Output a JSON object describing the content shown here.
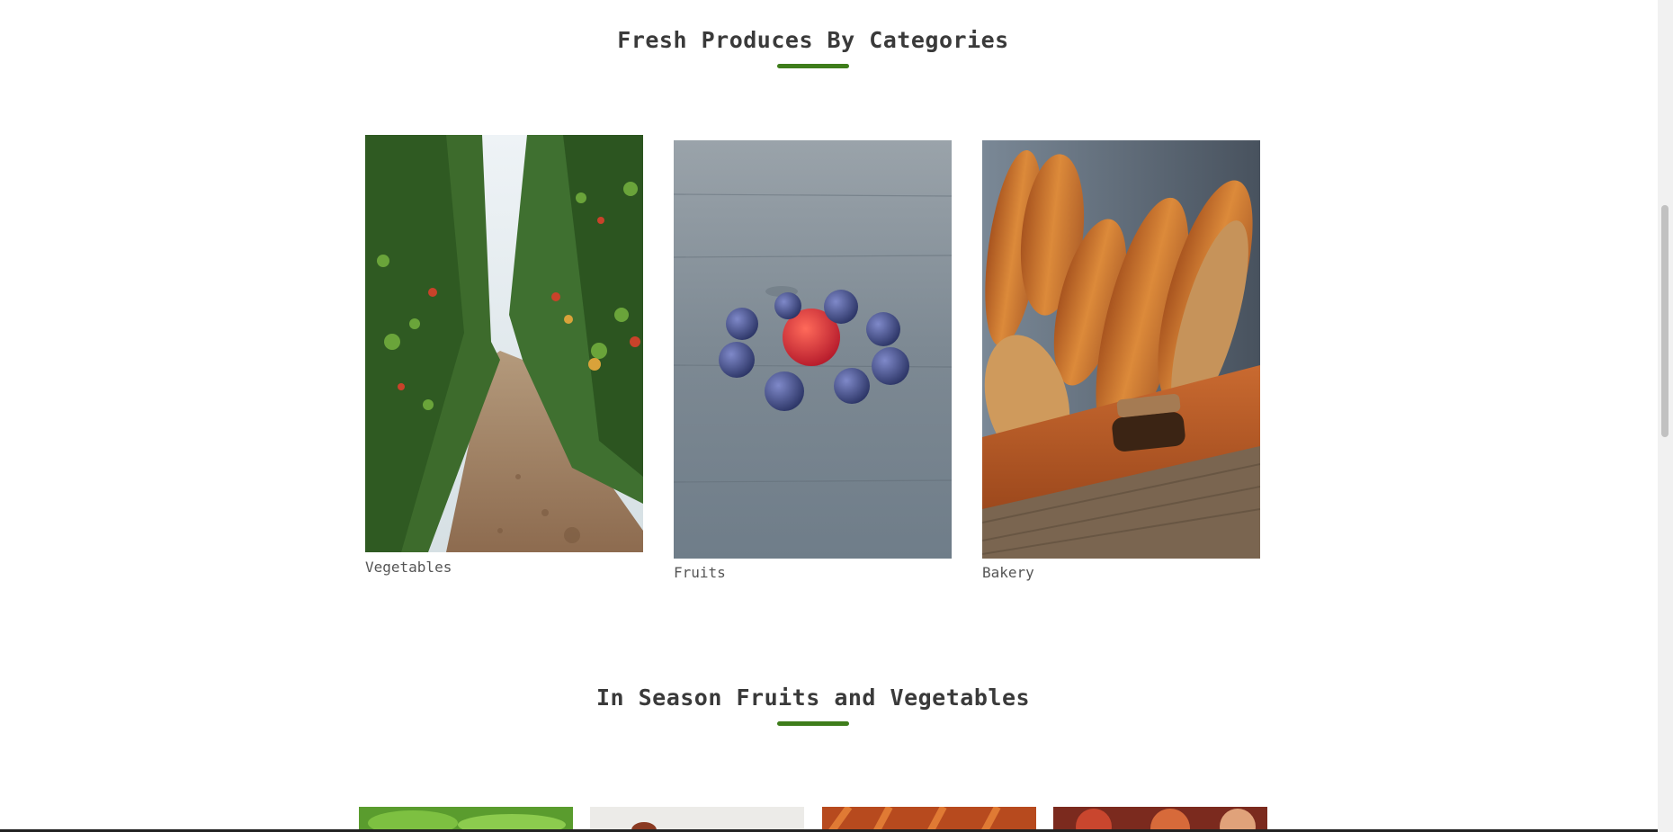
{
  "sections": {
    "categories_title": "Fresh Produces By Categories",
    "season_title": "In Season Fruits and Vegetables"
  },
  "categories": [
    {
      "label": "Vegetables",
      "image": "greenhouse-tomato-rows"
    },
    {
      "label": "Fruits",
      "image": "strawberry-blueberries-on-wood"
    },
    {
      "label": "Bakery",
      "image": "bread-loaves-in-basket"
    }
  ],
  "season_items": [
    {
      "image": "lettuce"
    },
    {
      "image": "red-fruit"
    },
    {
      "image": "carrots"
    },
    {
      "image": "apples"
    }
  ],
  "colors": {
    "accent": "#3e7d1b",
    "heading": "#3a3a3a",
    "caption": "#555555"
  }
}
